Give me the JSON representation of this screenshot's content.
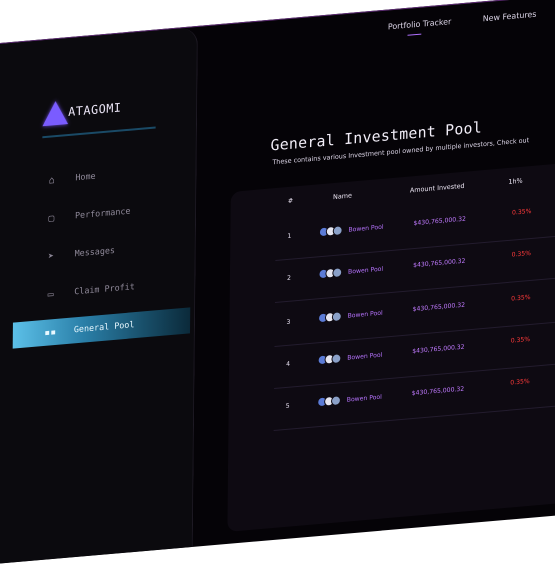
{
  "brand": {
    "name": "ATAGOMI"
  },
  "topnav": {
    "tabs": [
      "Portfolio Tracker",
      "New Features"
    ]
  },
  "sidebar": {
    "items": [
      {
        "label": "Home",
        "icon": "home-icon",
        "active": false
      },
      {
        "label": "Performance",
        "icon": "document-icon",
        "active": false
      },
      {
        "label": "Messages",
        "icon": "send-icon",
        "active": false
      },
      {
        "label": "Claim Profit",
        "icon": "wallet-icon",
        "active": false
      },
      {
        "label": "General Pool",
        "icon": "grid-icon",
        "active": true
      }
    ]
  },
  "page": {
    "title": "General Investment Pool",
    "subtitle": "These contains various Investment pool owned by multiple investors, Check out"
  },
  "table": {
    "headers": {
      "num": "#",
      "name": "Name",
      "amount": "Amount Invested",
      "pct": "1h%"
    },
    "rows": [
      {
        "num": "1",
        "name": "Bowen Pool",
        "amount": "$430,765,000.32",
        "pct": "0.35%"
      },
      {
        "num": "2",
        "name": "Bowen Pool",
        "amount": "$430,765,000.32",
        "pct": "0.35%"
      },
      {
        "num": "3",
        "name": "Bowen Pool",
        "amount": "$430,765,000.32",
        "pct": "0.35%"
      },
      {
        "num": "4",
        "name": "Bowen Pool",
        "amount": "$430,765,000.32",
        "pct": "0.35%"
      },
      {
        "num": "5",
        "name": "Bowen Pool",
        "amount": "$430,765,000.32",
        "pct": "0.35%"
      }
    ]
  },
  "colors": {
    "accent": "#5cc0e8",
    "purple": "#b774ff",
    "negative": "#ff3a3a"
  }
}
